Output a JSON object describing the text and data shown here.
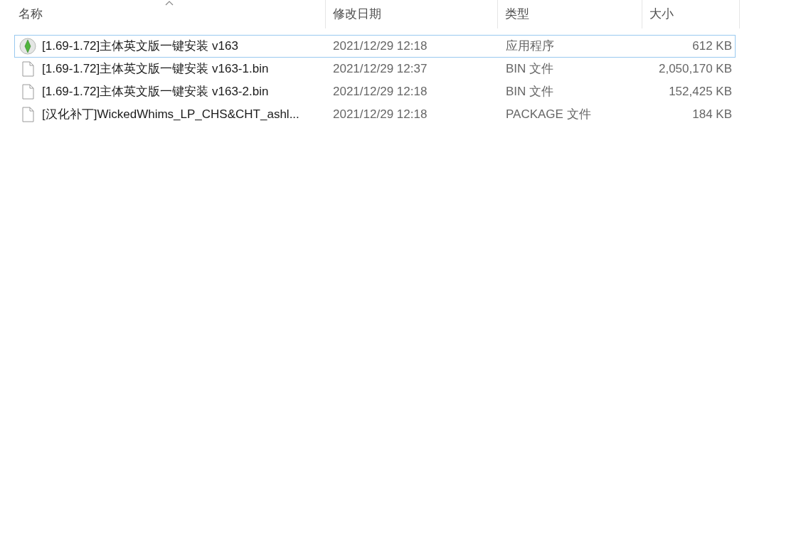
{
  "columns": [
    {
      "label": "名称",
      "sorted": true
    },
    {
      "label": "修改日期",
      "sorted": false
    },
    {
      "label": "类型",
      "sorted": false
    },
    {
      "label": "大小",
      "sorted": false
    }
  ],
  "files": [
    {
      "kind": "app",
      "name": "[1.69-1.72]主体英文版一键安装 v163",
      "modified": "2021/12/29 12:18",
      "type": "应用程序",
      "size": "612 KB",
      "focused": true
    },
    {
      "kind": "file",
      "name": "[1.69-1.72]主体英文版一键安装 v163-1.bin",
      "modified": "2021/12/29 12:37",
      "type": "BIN 文件",
      "size": "2,050,170 KB",
      "focused": false
    },
    {
      "kind": "file",
      "name": "[1.69-1.72]主体英文版一键安装 v163-2.bin",
      "modified": "2021/12/29 12:18",
      "type": "BIN 文件",
      "size": "152,425 KB",
      "focused": false
    },
    {
      "kind": "file",
      "name": "[汉化补丁]WickedWhims_LP_CHS&CHT_ashl...",
      "modified": "2021/12/29 12:18",
      "type": "PACKAGE 文件",
      "size": "184 KB",
      "focused": false
    }
  ]
}
